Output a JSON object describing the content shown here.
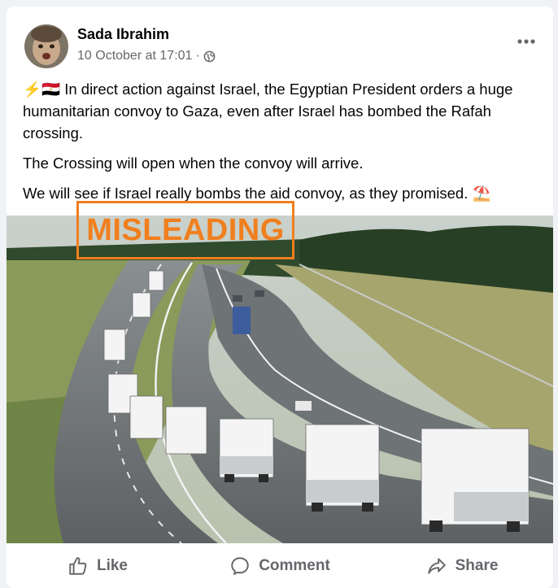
{
  "post": {
    "author": "Sada Ibrahim",
    "timestamp": "10 October at 17:01",
    "separator": "·",
    "audience_icon": "globe-icon",
    "menu_icon": "more-options-icon",
    "paragraphs": [
      "In direct action against Israel, the Egyptian President orders a huge humanitarian convoy to Gaza, even after Israel has bombed the Rafah crossing.",
      "The Crossing will open when the convoy will arrive.",
      "We will see if Israel really bombs the aid convoy, as they promised."
    ],
    "leading_emoji": "⚡🇪🇬",
    "trailing_emoji": "⛱️",
    "image_stamp": "MISLEADING"
  },
  "actions": {
    "like": "Like",
    "comment": "Comment",
    "share": "Share"
  },
  "colors": {
    "stamp": "#f07f1e",
    "text": "#050505",
    "secondary": "#65676b"
  }
}
